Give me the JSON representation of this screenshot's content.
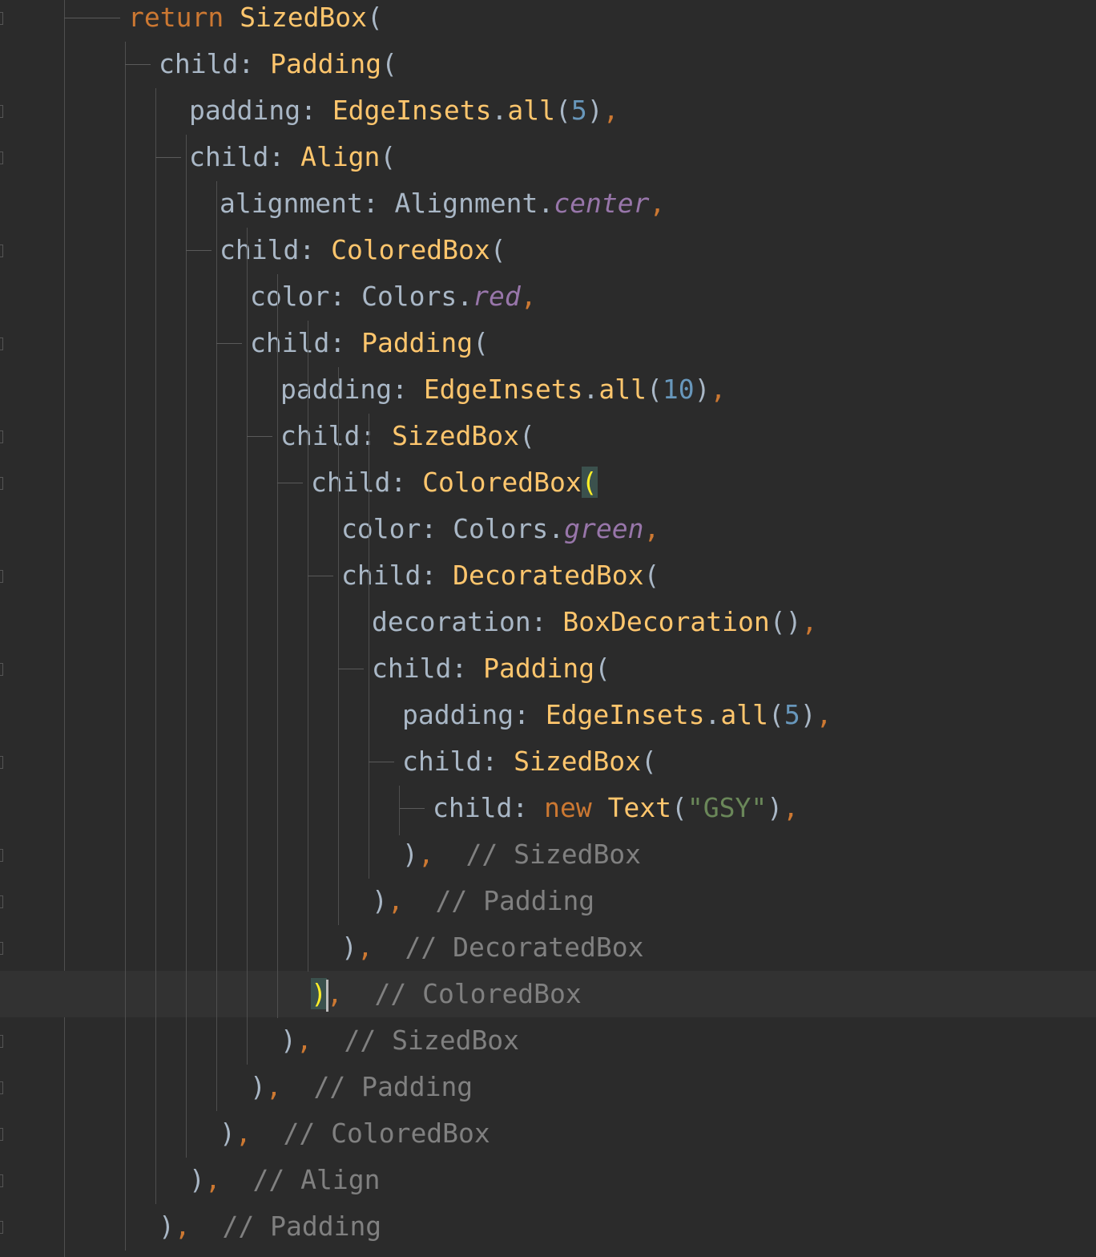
{
  "editor": {
    "theme": "darcula",
    "colors": {
      "background": "#2b2b2b",
      "keyword": "#cc7832",
      "class": "#ffc66d",
      "identifier": "#a9b7c6",
      "number": "#6897bb",
      "string": "#6a8759",
      "constant": "#9876aa",
      "comment": "#808080",
      "bracket_match": "#ffef28"
    },
    "lines": [
      {
        "indent": 0,
        "current": false,
        "tokens": [
          {
            "k": "kw",
            "t": "return"
          },
          {
            "k": "id",
            "t": " "
          },
          {
            "k": "cls",
            "t": "SizedBox"
          },
          {
            "k": "punc",
            "t": "("
          }
        ]
      },
      {
        "indent": 1,
        "current": false,
        "tokens": [
          {
            "k": "id",
            "t": "child: "
          },
          {
            "k": "cls",
            "t": "Padding"
          },
          {
            "k": "punc",
            "t": "("
          }
        ]
      },
      {
        "indent": 2,
        "current": false,
        "tokens": [
          {
            "k": "id",
            "t": "padding: "
          },
          {
            "k": "cls",
            "t": "EdgeInsets"
          },
          {
            "k": "punc",
            "t": "."
          },
          {
            "k": "cls",
            "t": "all"
          },
          {
            "k": "punc",
            "t": "("
          },
          {
            "k": "num",
            "t": "5"
          },
          {
            "k": "punc",
            "t": ")"
          },
          {
            "k": "comma",
            "t": ","
          }
        ]
      },
      {
        "indent": 2,
        "current": false,
        "tokens": [
          {
            "k": "id",
            "t": "child: "
          },
          {
            "k": "cls",
            "t": "Align"
          },
          {
            "k": "punc",
            "t": "("
          }
        ]
      },
      {
        "indent": 3,
        "current": false,
        "tokens": [
          {
            "k": "id",
            "t": "alignment: Alignment."
          },
          {
            "k": "const",
            "t": "center"
          },
          {
            "k": "comma",
            "t": ","
          }
        ]
      },
      {
        "indent": 3,
        "current": false,
        "tokens": [
          {
            "k": "id",
            "t": "child: "
          },
          {
            "k": "cls",
            "t": "ColoredBox"
          },
          {
            "k": "punc",
            "t": "("
          }
        ]
      },
      {
        "indent": 4,
        "current": false,
        "tokens": [
          {
            "k": "id",
            "t": "color: Colors."
          },
          {
            "k": "const",
            "t": "red"
          },
          {
            "k": "comma",
            "t": ","
          }
        ]
      },
      {
        "indent": 4,
        "current": false,
        "tokens": [
          {
            "k": "id",
            "t": "child: "
          },
          {
            "k": "cls",
            "t": "Padding"
          },
          {
            "k": "punc",
            "t": "("
          }
        ]
      },
      {
        "indent": 5,
        "current": false,
        "tokens": [
          {
            "k": "id",
            "t": "padding: "
          },
          {
            "k": "cls",
            "t": "EdgeInsets"
          },
          {
            "k": "punc",
            "t": "."
          },
          {
            "k": "cls",
            "t": "all"
          },
          {
            "k": "punc",
            "t": "("
          },
          {
            "k": "num",
            "t": "10"
          },
          {
            "k": "punc",
            "t": ")"
          },
          {
            "k": "comma",
            "t": ","
          }
        ]
      },
      {
        "indent": 5,
        "current": false,
        "tokens": [
          {
            "k": "id",
            "t": "child: "
          },
          {
            "k": "cls",
            "t": "SizedBox"
          },
          {
            "k": "punc",
            "t": "("
          }
        ]
      },
      {
        "indent": 6,
        "current": false,
        "tokens": [
          {
            "k": "id",
            "t": "child: "
          },
          {
            "k": "cls",
            "t": "ColoredBox"
          },
          {
            "k": "hl",
            "t": "("
          }
        ]
      },
      {
        "indent": 7,
        "current": false,
        "tokens": [
          {
            "k": "id",
            "t": "color: Colors."
          },
          {
            "k": "const",
            "t": "green"
          },
          {
            "k": "comma",
            "t": ","
          }
        ]
      },
      {
        "indent": 7,
        "current": false,
        "tokens": [
          {
            "k": "id",
            "t": "child: "
          },
          {
            "k": "cls",
            "t": "DecoratedBox"
          },
          {
            "k": "punc",
            "t": "("
          }
        ]
      },
      {
        "indent": 8,
        "current": false,
        "tokens": [
          {
            "k": "id",
            "t": "decoration: "
          },
          {
            "k": "cls",
            "t": "BoxDecoration"
          },
          {
            "k": "punc",
            "t": "()"
          },
          {
            "k": "comma",
            "t": ","
          }
        ]
      },
      {
        "indent": 8,
        "current": false,
        "tokens": [
          {
            "k": "id",
            "t": "child: "
          },
          {
            "k": "cls",
            "t": "Padding"
          },
          {
            "k": "punc",
            "t": "("
          }
        ]
      },
      {
        "indent": 9,
        "current": false,
        "tokens": [
          {
            "k": "id",
            "t": "padding: "
          },
          {
            "k": "cls",
            "t": "EdgeInsets"
          },
          {
            "k": "punc",
            "t": "."
          },
          {
            "k": "cls",
            "t": "all"
          },
          {
            "k": "punc",
            "t": "("
          },
          {
            "k": "num",
            "t": "5"
          },
          {
            "k": "punc",
            "t": ")"
          },
          {
            "k": "comma",
            "t": ","
          }
        ]
      },
      {
        "indent": 9,
        "current": false,
        "tokens": [
          {
            "k": "id",
            "t": "child: "
          },
          {
            "k": "cls",
            "t": "SizedBox"
          },
          {
            "k": "punc",
            "t": "("
          }
        ]
      },
      {
        "indent": 10,
        "current": false,
        "tokens": [
          {
            "k": "id",
            "t": "child: "
          },
          {
            "k": "kw",
            "t": "new"
          },
          {
            "k": "id",
            "t": " "
          },
          {
            "k": "cls",
            "t": "Text"
          },
          {
            "k": "punc",
            "t": "("
          },
          {
            "k": "str",
            "t": "\"GSY\""
          },
          {
            "k": "punc",
            "t": ")"
          },
          {
            "k": "comma",
            "t": ","
          }
        ]
      },
      {
        "indent": 9,
        "current": false,
        "tokens": [
          {
            "k": "punc",
            "t": ")"
          },
          {
            "k": "comma",
            "t": ","
          },
          {
            "k": "id",
            "t": "  "
          },
          {
            "k": "cmt",
            "t": "// SizedBox"
          }
        ]
      },
      {
        "indent": 8,
        "current": false,
        "tokens": [
          {
            "k": "punc",
            "t": ")"
          },
          {
            "k": "comma",
            "t": ","
          },
          {
            "k": "id",
            "t": "  "
          },
          {
            "k": "cmt",
            "t": "// Padding"
          }
        ]
      },
      {
        "indent": 7,
        "current": false,
        "tokens": [
          {
            "k": "punc",
            "t": ")"
          },
          {
            "k": "comma",
            "t": ","
          },
          {
            "k": "id",
            "t": "  "
          },
          {
            "k": "cmt",
            "t": "// DecoratedBox"
          }
        ]
      },
      {
        "indent": 6,
        "current": true,
        "tokens": [
          {
            "k": "hl",
            "t": ")"
          },
          {
            "k": "caret",
            "t": ""
          },
          {
            "k": "comma",
            "t": ","
          },
          {
            "k": "id",
            "t": "  "
          },
          {
            "k": "cmt",
            "t": "// ColoredBox"
          }
        ]
      },
      {
        "indent": 5,
        "current": false,
        "tokens": [
          {
            "k": "punc",
            "t": ")"
          },
          {
            "k": "comma",
            "t": ","
          },
          {
            "k": "id",
            "t": "  "
          },
          {
            "k": "cmt",
            "t": "// SizedBox"
          }
        ]
      },
      {
        "indent": 4,
        "current": false,
        "tokens": [
          {
            "k": "punc",
            "t": ")"
          },
          {
            "k": "comma",
            "t": ","
          },
          {
            "k": "id",
            "t": "  "
          },
          {
            "k": "cmt",
            "t": "// Padding"
          }
        ]
      },
      {
        "indent": 3,
        "current": false,
        "tokens": [
          {
            "k": "punc",
            "t": ")"
          },
          {
            "k": "comma",
            "t": ","
          },
          {
            "k": "id",
            "t": "  "
          },
          {
            "k": "cmt",
            "t": "// ColoredBox"
          }
        ]
      },
      {
        "indent": 2,
        "current": false,
        "tokens": [
          {
            "k": "punc",
            "t": ")"
          },
          {
            "k": "comma",
            "t": ","
          },
          {
            "k": "id",
            "t": "  "
          },
          {
            "k": "cmt",
            "t": "// Align"
          }
        ]
      },
      {
        "indent": 1,
        "current": false,
        "tokens": [
          {
            "k": "punc",
            "t": ")"
          },
          {
            "k": "comma",
            "t": ","
          },
          {
            "k": "id",
            "t": "  "
          },
          {
            "k": "cmt",
            "t": "// Padding"
          }
        ]
      }
    ]
  }
}
